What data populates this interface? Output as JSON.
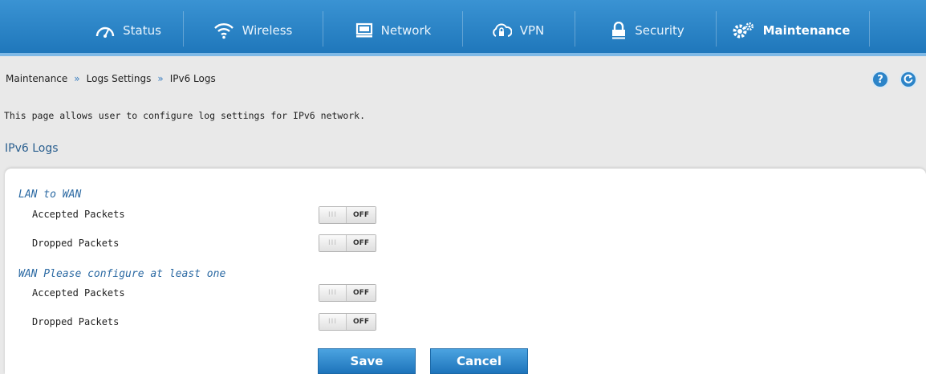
{
  "nav": {
    "items": [
      {
        "label": "Status",
        "icon": "gauge-icon"
      },
      {
        "label": "Wireless",
        "icon": "wifi-icon"
      },
      {
        "label": "Network",
        "icon": "monitor-icon"
      },
      {
        "label": "VPN",
        "icon": "cloud-lock-icon"
      },
      {
        "label": "Security",
        "icon": "lock-icon"
      },
      {
        "label": "Maintenance",
        "icon": "gears-icon",
        "active": true
      }
    ]
  },
  "breadcrumb": [
    "Maintenance",
    "Logs Settings",
    "IPv6 Logs"
  ],
  "breadcrumb_separator": "»",
  "help_label": "?",
  "description": "This page allows user to configure log settings for IPv6 network.",
  "section_title": "IPv6 Logs",
  "groups": [
    {
      "title": "LAN to WAN",
      "rows": [
        {
          "label": "Accepted Packets",
          "state": "OFF"
        },
        {
          "label": "Dropped Packets",
          "state": "OFF"
        }
      ]
    },
    {
      "title": "WAN Please configure at least one",
      "rows": [
        {
          "label": "Accepted Packets",
          "state": "OFF"
        },
        {
          "label": "Dropped Packets",
          "state": "OFF"
        }
      ]
    }
  ],
  "toggle_grip": "III",
  "buttons": {
    "save": "Save",
    "cancel": "Cancel"
  },
  "colors": {
    "nav": "#2a86c9",
    "accent": "#2c6aa3",
    "button": "#2a82c6"
  }
}
